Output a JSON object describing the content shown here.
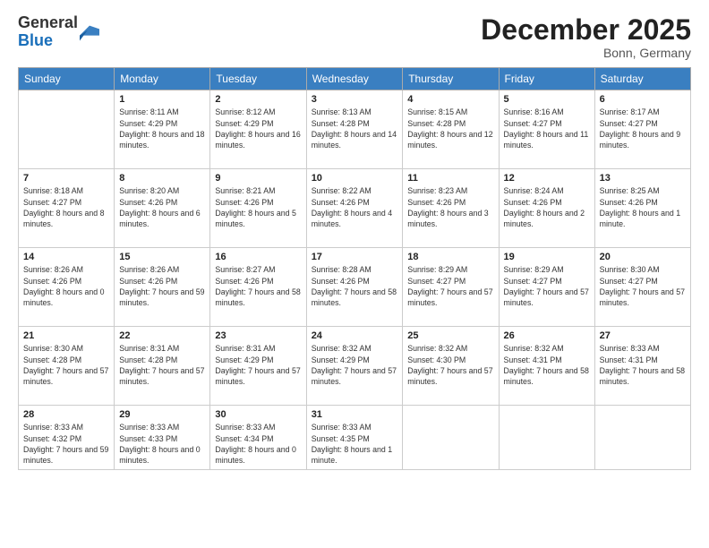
{
  "logo": {
    "general": "General",
    "blue": "Blue"
  },
  "title": "December 2025",
  "location": "Bonn, Germany",
  "headers": [
    "Sunday",
    "Monday",
    "Tuesday",
    "Wednesday",
    "Thursday",
    "Friday",
    "Saturday"
  ],
  "weeks": [
    [
      {
        "day": "",
        "sunrise": "",
        "sunset": "",
        "daylight": ""
      },
      {
        "day": "1",
        "sunrise": "Sunrise: 8:11 AM",
        "sunset": "Sunset: 4:29 PM",
        "daylight": "Daylight: 8 hours and 18 minutes."
      },
      {
        "day": "2",
        "sunrise": "Sunrise: 8:12 AM",
        "sunset": "Sunset: 4:29 PM",
        "daylight": "Daylight: 8 hours and 16 minutes."
      },
      {
        "day": "3",
        "sunrise": "Sunrise: 8:13 AM",
        "sunset": "Sunset: 4:28 PM",
        "daylight": "Daylight: 8 hours and 14 minutes."
      },
      {
        "day": "4",
        "sunrise": "Sunrise: 8:15 AM",
        "sunset": "Sunset: 4:28 PM",
        "daylight": "Daylight: 8 hours and 12 minutes."
      },
      {
        "day": "5",
        "sunrise": "Sunrise: 8:16 AM",
        "sunset": "Sunset: 4:27 PM",
        "daylight": "Daylight: 8 hours and 11 minutes."
      },
      {
        "day": "6",
        "sunrise": "Sunrise: 8:17 AM",
        "sunset": "Sunset: 4:27 PM",
        "daylight": "Daylight: 8 hours and 9 minutes."
      }
    ],
    [
      {
        "day": "7",
        "sunrise": "Sunrise: 8:18 AM",
        "sunset": "Sunset: 4:27 PM",
        "daylight": "Daylight: 8 hours and 8 minutes."
      },
      {
        "day": "8",
        "sunrise": "Sunrise: 8:20 AM",
        "sunset": "Sunset: 4:26 PM",
        "daylight": "Daylight: 8 hours and 6 minutes."
      },
      {
        "day": "9",
        "sunrise": "Sunrise: 8:21 AM",
        "sunset": "Sunset: 4:26 PM",
        "daylight": "Daylight: 8 hours and 5 minutes."
      },
      {
        "day": "10",
        "sunrise": "Sunrise: 8:22 AM",
        "sunset": "Sunset: 4:26 PM",
        "daylight": "Daylight: 8 hours and 4 minutes."
      },
      {
        "day": "11",
        "sunrise": "Sunrise: 8:23 AM",
        "sunset": "Sunset: 4:26 PM",
        "daylight": "Daylight: 8 hours and 3 minutes."
      },
      {
        "day": "12",
        "sunrise": "Sunrise: 8:24 AM",
        "sunset": "Sunset: 4:26 PM",
        "daylight": "Daylight: 8 hours and 2 minutes."
      },
      {
        "day": "13",
        "sunrise": "Sunrise: 8:25 AM",
        "sunset": "Sunset: 4:26 PM",
        "daylight": "Daylight: 8 hours and 1 minute."
      }
    ],
    [
      {
        "day": "14",
        "sunrise": "Sunrise: 8:26 AM",
        "sunset": "Sunset: 4:26 PM",
        "daylight": "Daylight: 8 hours and 0 minutes."
      },
      {
        "day": "15",
        "sunrise": "Sunrise: 8:26 AM",
        "sunset": "Sunset: 4:26 PM",
        "daylight": "Daylight: 7 hours and 59 minutes."
      },
      {
        "day": "16",
        "sunrise": "Sunrise: 8:27 AM",
        "sunset": "Sunset: 4:26 PM",
        "daylight": "Daylight: 7 hours and 58 minutes."
      },
      {
        "day": "17",
        "sunrise": "Sunrise: 8:28 AM",
        "sunset": "Sunset: 4:26 PM",
        "daylight": "Daylight: 7 hours and 58 minutes."
      },
      {
        "day": "18",
        "sunrise": "Sunrise: 8:29 AM",
        "sunset": "Sunset: 4:27 PM",
        "daylight": "Daylight: 7 hours and 57 minutes."
      },
      {
        "day": "19",
        "sunrise": "Sunrise: 8:29 AM",
        "sunset": "Sunset: 4:27 PM",
        "daylight": "Daylight: 7 hours and 57 minutes."
      },
      {
        "day": "20",
        "sunrise": "Sunrise: 8:30 AM",
        "sunset": "Sunset: 4:27 PM",
        "daylight": "Daylight: 7 hours and 57 minutes."
      }
    ],
    [
      {
        "day": "21",
        "sunrise": "Sunrise: 8:30 AM",
        "sunset": "Sunset: 4:28 PM",
        "daylight": "Daylight: 7 hours and 57 minutes."
      },
      {
        "day": "22",
        "sunrise": "Sunrise: 8:31 AM",
        "sunset": "Sunset: 4:28 PM",
        "daylight": "Daylight: 7 hours and 57 minutes."
      },
      {
        "day": "23",
        "sunrise": "Sunrise: 8:31 AM",
        "sunset": "Sunset: 4:29 PM",
        "daylight": "Daylight: 7 hours and 57 minutes."
      },
      {
        "day": "24",
        "sunrise": "Sunrise: 8:32 AM",
        "sunset": "Sunset: 4:29 PM",
        "daylight": "Daylight: 7 hours and 57 minutes."
      },
      {
        "day": "25",
        "sunrise": "Sunrise: 8:32 AM",
        "sunset": "Sunset: 4:30 PM",
        "daylight": "Daylight: 7 hours and 57 minutes."
      },
      {
        "day": "26",
        "sunrise": "Sunrise: 8:32 AM",
        "sunset": "Sunset: 4:31 PM",
        "daylight": "Daylight: 7 hours and 58 minutes."
      },
      {
        "day": "27",
        "sunrise": "Sunrise: 8:33 AM",
        "sunset": "Sunset: 4:31 PM",
        "daylight": "Daylight: 7 hours and 58 minutes."
      }
    ],
    [
      {
        "day": "28",
        "sunrise": "Sunrise: 8:33 AM",
        "sunset": "Sunset: 4:32 PM",
        "daylight": "Daylight: 7 hours and 59 minutes."
      },
      {
        "day": "29",
        "sunrise": "Sunrise: 8:33 AM",
        "sunset": "Sunset: 4:33 PM",
        "daylight": "Daylight: 8 hours and 0 minutes."
      },
      {
        "day": "30",
        "sunrise": "Sunrise: 8:33 AM",
        "sunset": "Sunset: 4:34 PM",
        "daylight": "Daylight: 8 hours and 0 minutes."
      },
      {
        "day": "31",
        "sunrise": "Sunrise: 8:33 AM",
        "sunset": "Sunset: 4:35 PM",
        "daylight": "Daylight: 8 hours and 1 minute."
      },
      {
        "day": "",
        "sunrise": "",
        "sunset": "",
        "daylight": ""
      },
      {
        "day": "",
        "sunrise": "",
        "sunset": "",
        "daylight": ""
      },
      {
        "day": "",
        "sunrise": "",
        "sunset": "",
        "daylight": ""
      }
    ]
  ]
}
